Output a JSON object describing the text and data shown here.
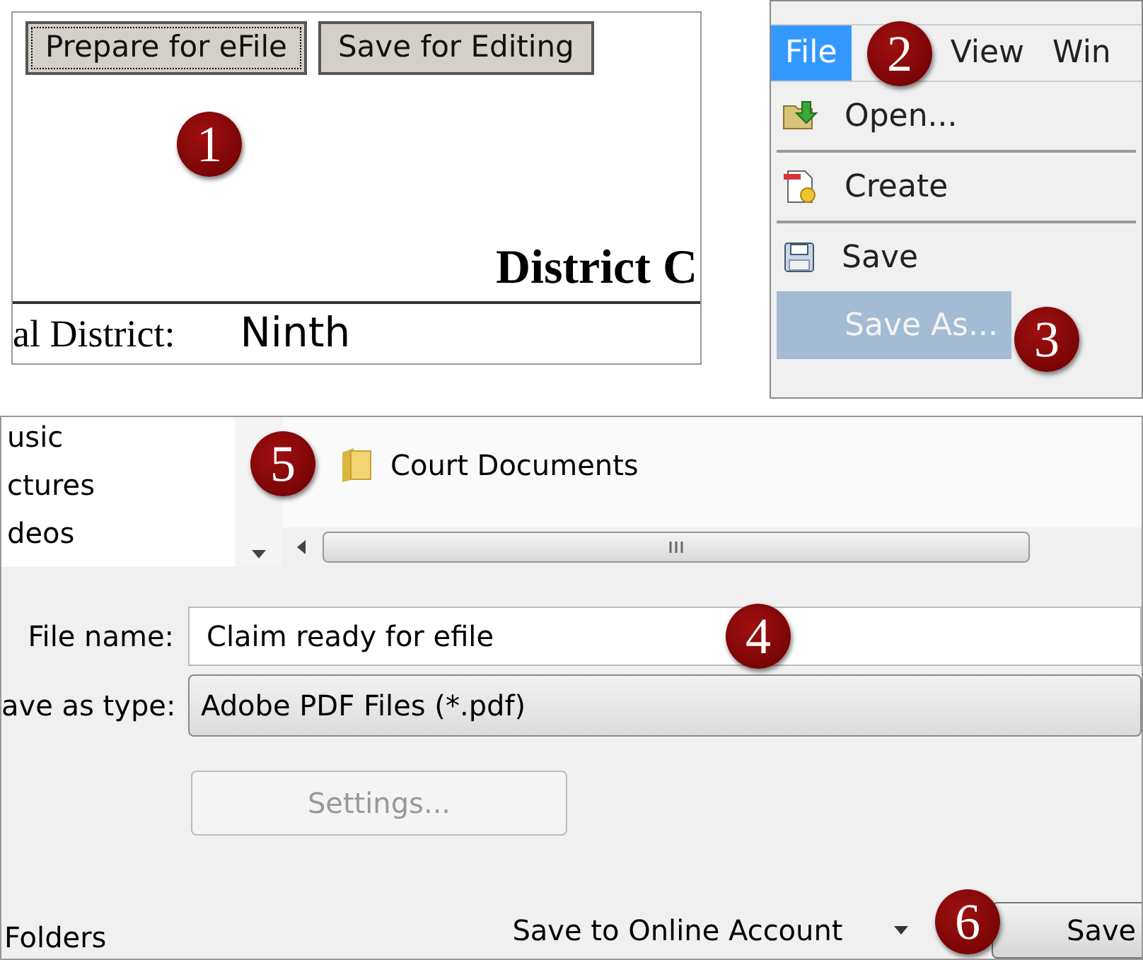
{
  "form_page": {
    "buttons": [
      {
        "label": "Prepare for eFile",
        "focused": true
      },
      {
        "label": "Save for Editing",
        "focused": false
      }
    ],
    "heading": "District C",
    "field_label": "al District:",
    "field_value": "Ninth",
    "callout": "1"
  },
  "menu": {
    "menubar": [
      {
        "label": "File",
        "selected": true
      },
      {
        "label": "View",
        "selected": false
      },
      {
        "label": "Win",
        "selected": false
      }
    ],
    "items": [
      {
        "label": "Open...",
        "kind": "open",
        "selected": false
      },
      {
        "label": "Create",
        "kind": "create",
        "selected": false
      },
      {
        "label": "Save",
        "kind": "save",
        "selected": false
      },
      {
        "label": "Save As...",
        "kind": "none",
        "selected": true
      }
    ],
    "callouts": [
      "2",
      "3"
    ]
  },
  "save_dialog": {
    "nav_items": [
      "usic",
      "ctures",
      "deos"
    ],
    "folder": "Court Documents",
    "callout_folder": "5",
    "file_name_label": "File name:",
    "file_name": "Claim ready for efile",
    "callout_file_name": "4",
    "type_label": "ave as type:",
    "type_value": "Adobe PDF Files (*.pdf)",
    "settings_button": {
      "label": "Settings...",
      "disabled": true
    },
    "folders_toggle": "Folders",
    "online_account": "Save to Online Account",
    "save_button": "Save",
    "callout_save": "6"
  }
}
